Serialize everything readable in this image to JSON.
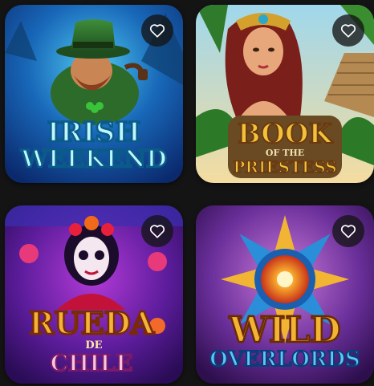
{
  "games": [
    {
      "id": "irish",
      "title_line1": "IRISH",
      "title_line2": "WEEKEND",
      "favorite_icon": "heart-outline-icon",
      "accent": "#1fd0e8"
    },
    {
      "id": "priestess",
      "title_line1": "BOOK",
      "title_line2": "OF THE",
      "title_line3": "PRIESTESS",
      "favorite_icon": "heart-outline-icon",
      "accent": "#f3c23a"
    },
    {
      "id": "rueda",
      "title_line1": "RUEDA",
      "title_line2": "DE",
      "title_line3": "CHILE",
      "favorite_icon": "heart-outline-icon",
      "accent": "#f2b33a"
    },
    {
      "id": "wild",
      "title_line1": "WILD",
      "title_line2": "OVERLORDS",
      "favorite_icon": "heart-outline-icon",
      "accent": "#f2b533"
    }
  ]
}
